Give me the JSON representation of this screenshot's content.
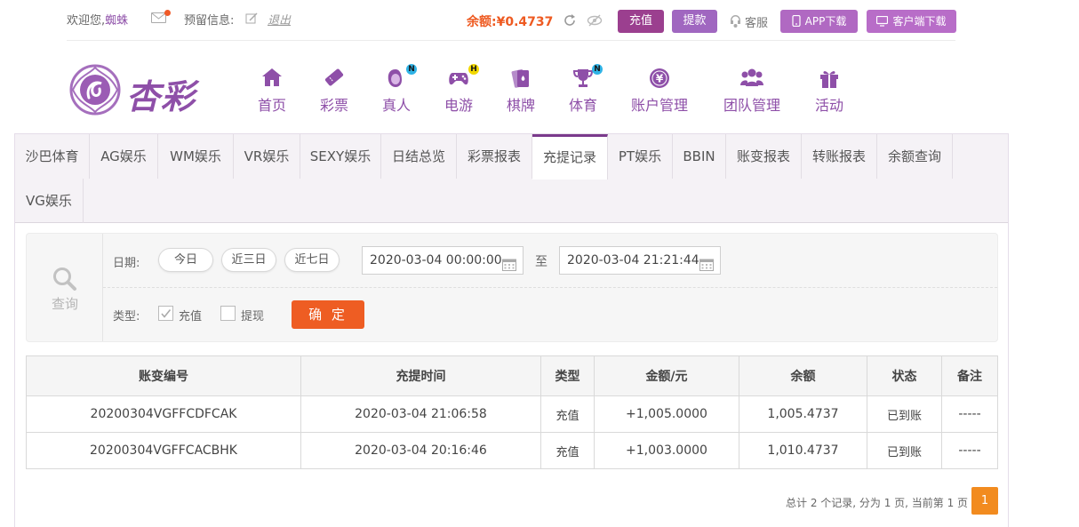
{
  "topbar": {
    "welcome": "欢迎您,",
    "username": "蜘蛛",
    "reserve_label": "预留信息:",
    "logout": "退出",
    "balance_label": "余额:",
    "balance_value": "¥0.4737",
    "recharge": "充值",
    "withdraw": "提款",
    "customer_service": "客服",
    "app_download": "APP下载",
    "client_download": "客户端下载"
  },
  "logo": {
    "text": "杏彩"
  },
  "nav": [
    {
      "label": "首页",
      "icon": "home-icon"
    },
    {
      "label": "彩票",
      "icon": "ticket-icon"
    },
    {
      "label": "真人",
      "icon": "live-dealer-icon",
      "badge": "N"
    },
    {
      "label": "电游",
      "icon": "gamepad-icon",
      "badge": "H"
    },
    {
      "label": "棋牌",
      "icon": "cards-icon"
    },
    {
      "label": "体育",
      "icon": "trophy-icon",
      "badge": "N"
    },
    {
      "label": "账户管理",
      "icon": "yen-coin-icon"
    },
    {
      "label": "团队管理",
      "icon": "team-icon"
    },
    {
      "label": "活动",
      "icon": "gift-icon"
    }
  ],
  "tabs": [
    "沙巴体育",
    "AG娱乐",
    "WM娱乐",
    "VR娱乐",
    "SEXY娱乐",
    "日结总览",
    "彩票报表",
    "充提记录",
    "PT娱乐",
    "BBIN",
    "账变报表",
    "转账报表",
    "余额查询",
    "VG娱乐"
  ],
  "active_tab": "充提记录",
  "query": {
    "side_label": "查询",
    "date_label": "日期:",
    "quick": [
      "今日",
      "近三日",
      "近七日"
    ],
    "start": "2020-03-04 00:00:00",
    "to": "至",
    "end": "2020-03-04 21:21:44",
    "type_label": "类型:",
    "type_recharge": "充值",
    "type_withdraw": "提现",
    "recharge_checked": true,
    "withdraw_checked": false,
    "confirm": "确 定"
  },
  "table": {
    "headers": [
      "账变编号",
      "充提时间",
      "类型",
      "金额/元",
      "余额",
      "状态",
      "备注"
    ],
    "rows": [
      [
        "20200304VGFFCDFCAK",
        "2020-03-04 21:06:58",
        "充值",
        "+1,005.0000",
        "1,005.4737",
        "已到账",
        "-----"
      ],
      [
        "20200304VGFFCACBHK",
        "2020-03-04 20:16:46",
        "充值",
        "+1,003.0000",
        "1,010.4737",
        "已到账",
        "-----"
      ]
    ]
  },
  "pager": {
    "summary": "总计 2 个记录, 分为 1 页, 当前第 1 页",
    "current": "1"
  },
  "colors": {
    "brand_purple": "#8e4fa8",
    "orange": "#ee5d23",
    "amount_red": "#d81e1e",
    "status_green": "#24a736"
  }
}
